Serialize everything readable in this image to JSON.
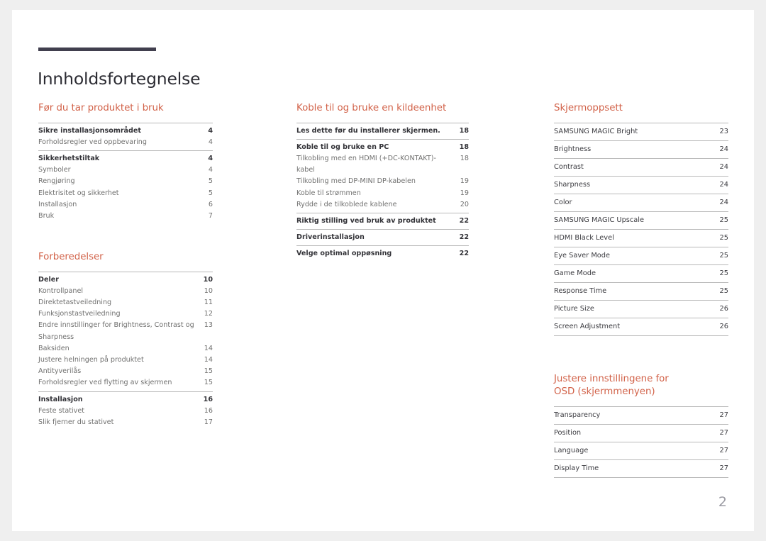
{
  "document": {
    "title": "Innholdsfortegnelse",
    "page_number": "2",
    "accent_color": "#d2634a",
    "rule_color": "#413f4e"
  },
  "columns": [
    {
      "sections": [
        {
          "heading": "Før du tar produktet i bruk",
          "groups": [
            {
              "rows": [
                {
                  "label": "Sikre installasjonsområdet",
                  "page": "4",
                  "level": "head"
                },
                {
                  "label": "Forholdsregler ved oppbevaring",
                  "page": "4",
                  "level": "sub"
                }
              ]
            },
            {
              "rows": [
                {
                  "label": "Sikkerhetstiltak",
                  "page": "4",
                  "level": "head"
                },
                {
                  "label": "Symboler",
                  "page": "4",
                  "level": "sub"
                },
                {
                  "label": "Rengjøring",
                  "page": "5",
                  "level": "sub"
                },
                {
                  "label": "Elektrisitet og sikkerhet",
                  "page": "5",
                  "level": "sub"
                },
                {
                  "label": "Installasjon",
                  "page": "6",
                  "level": "sub"
                },
                {
                  "label": "Bruk",
                  "page": "7",
                  "level": "sub"
                }
              ]
            }
          ]
        },
        {
          "heading": "Forberedelser",
          "groups": [
            {
              "rows": [
                {
                  "label": "Deler",
                  "page": "10",
                  "level": "head"
                },
                {
                  "label": "Kontrollpanel",
                  "page": "10",
                  "level": "sub"
                },
                {
                  "label": "Direktetastveiledning",
                  "page": "11",
                  "level": "sub"
                },
                {
                  "label": "Funksjonstastveiledning",
                  "page": "12",
                  "level": "sub"
                },
                {
                  "label": "Endre innstillinger for Brightness, Contrast og Sharpness",
                  "page": "13",
                  "level": "sub"
                },
                {
                  "label": "Baksiden",
                  "page": "14",
                  "level": "sub"
                },
                {
                  "label": "Justere helningen på produktet",
                  "page": "14",
                  "level": "sub"
                },
                {
                  "label": "Antityverilås",
                  "page": "15",
                  "level": "sub"
                },
                {
                  "label": "Forholdsregler ved flytting av skjermen",
                  "page": "15",
                  "level": "sub"
                }
              ]
            },
            {
              "rows": [
                {
                  "label": "Installasjon",
                  "page": "16",
                  "level": "head"
                },
                {
                  "label": "Feste stativet",
                  "page": "16",
                  "level": "sub"
                },
                {
                  "label": "Slik fjerner du stativet",
                  "page": "17",
                  "level": "sub"
                }
              ]
            }
          ]
        }
      ]
    },
    {
      "sections": [
        {
          "heading": "Koble til og bruke en kildeenhet",
          "groups": [
            {
              "rows": [
                {
                  "label": "Les dette før du installerer skjermen.",
                  "page": "18",
                  "level": "head"
                }
              ]
            },
            {
              "rows": [
                {
                  "label": "Koble til og bruke en PC",
                  "page": "18",
                  "level": "head"
                },
                {
                  "label": "Tilkobling med en HDMI (+DC-KONTAKT)-kabel",
                  "page": "18",
                  "level": "sub"
                },
                {
                  "label": "Tilkobling med DP-MINI DP-kabelen",
                  "page": "19",
                  "level": "sub"
                },
                {
                  "label": "Koble til strømmen",
                  "page": "19",
                  "level": "sub"
                },
                {
                  "label": "Rydde i de tilkoblede kablene",
                  "page": "20",
                  "level": "sub"
                }
              ]
            },
            {
              "rows": [
                {
                  "label": "Riktig stilling ved bruk av produktet",
                  "page": "22",
                  "level": "head"
                }
              ]
            },
            {
              "rows": [
                {
                  "label": "Driverinstallasjon",
                  "page": "22",
                  "level": "head"
                }
              ]
            },
            {
              "rows": [
                {
                  "label": "Velge optimal oppøsning",
                  "page": "22",
                  "level": "head"
                }
              ]
            }
          ]
        }
      ]
    },
    {
      "sections": [
        {
          "heading": "Skjermoppsett",
          "items": [
            {
              "label": "SAMSUNG MAGIC Bright",
              "page": "23"
            },
            {
              "label": "Brightness",
              "page": "24"
            },
            {
              "label": "Contrast",
              "page": "24"
            },
            {
              "label": "Sharpness",
              "page": "24"
            },
            {
              "label": "Color",
              "page": "24"
            },
            {
              "label": "SAMSUNG MAGIC Upscale",
              "page": "25"
            },
            {
              "label": "HDMI Black Level",
              "page": "25"
            },
            {
              "label": "Eye Saver Mode",
              "page": "25"
            },
            {
              "label": "Game Mode",
              "page": "25"
            },
            {
              "label": "Response Time",
              "page": "25"
            },
            {
              "label": "Picture Size",
              "page": "26"
            },
            {
              "label": "Screen Adjustment",
              "page": "26"
            }
          ]
        },
        {
          "heading": "Justere innstillingene for\nOSD (skjermmenyen)",
          "items": [
            {
              "label": "Transparency",
              "page": "27"
            },
            {
              "label": "Position",
              "page": "27"
            },
            {
              "label": "Language",
              "page": "27"
            },
            {
              "label": "Display Time",
              "page": "27"
            }
          ]
        }
      ]
    }
  ]
}
